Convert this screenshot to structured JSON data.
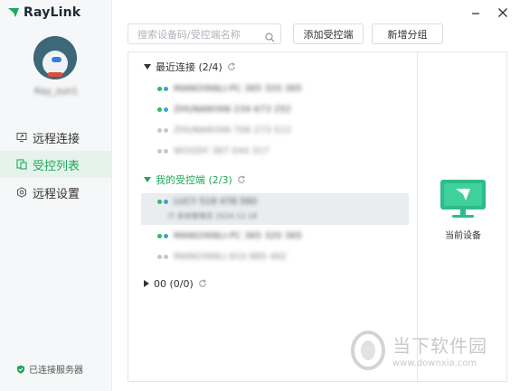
{
  "app": {
    "logo_text": "RayLink",
    "username": "Ray_sun1",
    "window_controls": {
      "minimize": "–",
      "close": "✕"
    }
  },
  "sidebar": {
    "items": [
      {
        "label": "远程连接",
        "icon": "remote-connect-icon",
        "active": false
      },
      {
        "label": "受控列表",
        "icon": "controlled-list-icon",
        "active": true
      },
      {
        "label": "远程设置",
        "icon": "gear-icon",
        "active": false
      }
    ],
    "status": "已连接服务器"
  },
  "toolbar": {
    "search_placeholder": "搜索设备码/受控端名称",
    "add_controlled_label": "添加受控端",
    "new_group_label": "新增分组"
  },
  "groups": [
    {
      "title": "最近连接 (2/4)",
      "expanded": true,
      "devices": [
        {
          "name": "MANGYANLI-PC  365 320 365",
          "online": true
        },
        {
          "name": "ZHUNANYAN  234 673 252",
          "online": true
        },
        {
          "name": "ZHUNANYAN  706 273 512",
          "online": false
        },
        {
          "name": "WOODY  387 044 317",
          "online": false
        }
      ]
    },
    {
      "title": "我的受控端 (2/3)",
      "expanded": true,
      "devices": [
        {
          "name": "LUCY  518 478 560",
          "online": true,
          "sub": "IT 系统管理员 2024.12.18",
          "selected": true
        },
        {
          "name": "MANGYANLI-PC  365 320 365",
          "online": true
        },
        {
          "name": "MANGYANLI  810 885 462",
          "online": false
        }
      ]
    },
    {
      "title": "00 (0/0)",
      "expanded": false,
      "devices": []
    }
  ],
  "side_panel": {
    "current_device_label": "当前设备"
  },
  "watermark": {
    "text": "当下软件园",
    "url": "www.downxia.com"
  },
  "colors": {
    "accent": "#1fa85a",
    "online_green": "#2ebc63",
    "online_teal": "#35a9c9",
    "offline": "#c4c8cc"
  }
}
